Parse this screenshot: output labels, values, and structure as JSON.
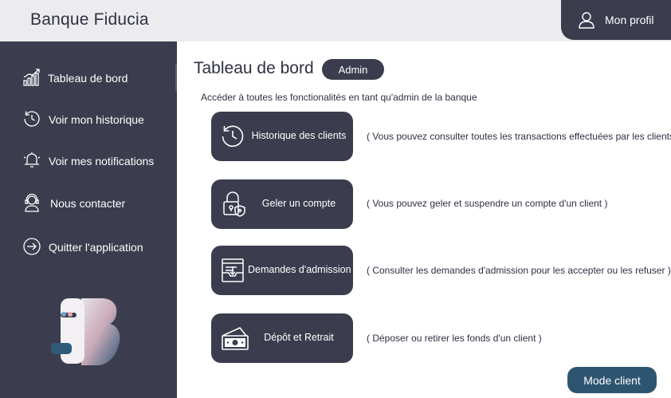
{
  "header": {
    "app_title": "Banque Fiducia",
    "profile_label": "Mon profil",
    "profile_icon": "user-icon"
  },
  "sidebar": {
    "items": [
      {
        "label": "Tableau de bord",
        "icon": "dashboard-chart-icon"
      },
      {
        "label": "Voir mon historique",
        "icon": "history-icon"
      },
      {
        "label": "Voir mes notifications",
        "icon": "bell-icon"
      },
      {
        "label": "Nous contacter",
        "icon": "support-agent-icon"
      },
      {
        "label": "Quitter l'application",
        "icon": "logout-icon"
      }
    ],
    "logo": "app-logo"
  },
  "main": {
    "title": "Tableau de bord",
    "role_badge": "Admin",
    "subtitle": "Accéder à toutes les fonctionalités en tant qu'admin de la banque",
    "actions": [
      {
        "label": "Historique des clients",
        "icon": "history-icon",
        "description": "( Vous pouvez consulter toutes les transactions effectuées par les clients"
      },
      {
        "label": "Geler un compte",
        "icon": "lock-icon",
        "description": "( Vous pouvez geler et suspendre un compte d'un client )"
      },
      {
        "label": "Demandes d'admission",
        "icon": "mail-inbox-icon",
        "description": "( Consulter les demandes d'admission pour les accepter ou les refuser )"
      },
      {
        "label": "Dépôt et Retrait",
        "icon": "money-icon",
        "description": "( Déposer ou retirer les fonds d'un client )"
      }
    ],
    "mode_button": "Mode client"
  },
  "colors": {
    "sidebar_bg": "#3b3d4e",
    "header_bg": "#ececee",
    "accent_button": "#2d5570"
  }
}
